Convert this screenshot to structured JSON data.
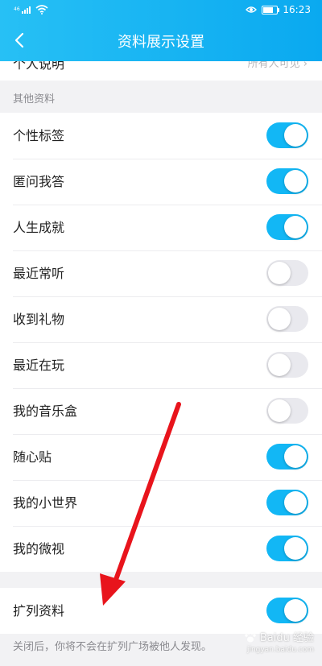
{
  "statusbar": {
    "signal": "46",
    "time": "16:23",
    "battery_level": 0.8
  },
  "header": {
    "title": "资料展示设置"
  },
  "partial_row": {
    "label": "个人说明",
    "value": "所有人可见 ›"
  },
  "section": {
    "title": "其他资料"
  },
  "toggles": [
    {
      "label": "个性标签",
      "on": true
    },
    {
      "label": "匿问我答",
      "on": true
    },
    {
      "label": "人生成就",
      "on": true
    },
    {
      "label": "最近常听",
      "on": false
    },
    {
      "label": "收到礼物",
      "on": false
    },
    {
      "label": "最近在玩",
      "on": false
    },
    {
      "label": "我的音乐盒",
      "on": false
    },
    {
      "label": "随心贴",
      "on": true
    },
    {
      "label": "我的小世界",
      "on": true
    },
    {
      "label": "我的微视",
      "on": true
    }
  ],
  "kuolie": {
    "label": "扩列资料",
    "on": true
  },
  "footer": {
    "note": "关闭后，你将不会在扩列广场被他人发现。"
  },
  "watermark": {
    "text": "Baidu 经验",
    "sub": "jingyan.baidu.com"
  },
  "colors": {
    "accent": "#12b7f5",
    "arrow": "#e8141c"
  }
}
